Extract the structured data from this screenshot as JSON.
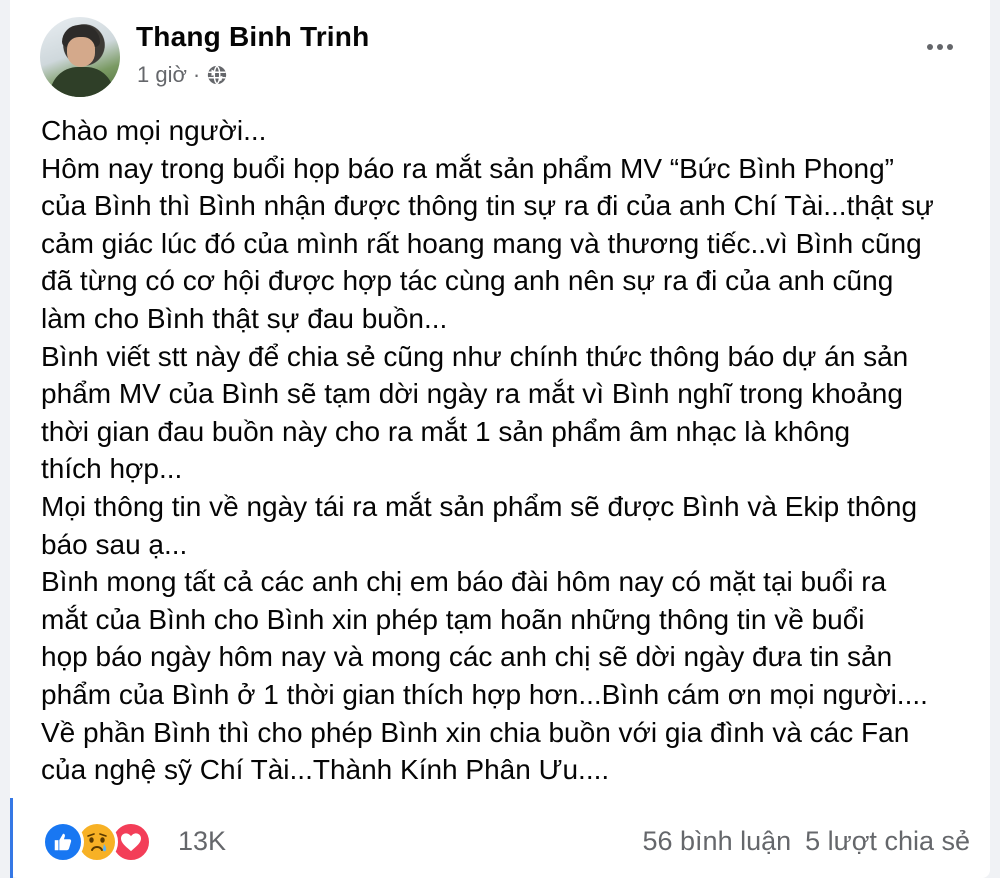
{
  "post": {
    "author": "Thang Binh Trinh",
    "time": "1 giờ",
    "separator": "·",
    "privacy_icon": "globe-icon",
    "lines": [
      "Chào mọi người...",
      "Hôm nay trong buổi họp báo ra mắt sản phẩm MV “Bức Bình Phong”",
      "của Bình thì Bình nhận được thông tin sự ra đi của anh Chí Tài...thật sự",
      "cảm giác lúc đó của mình rất hoang mang và thương tiếc..vì Bình cũng",
      "đã từng có cơ hội được hợp tác cùng anh nên sự ra đi của anh cũng",
      "làm cho Bình thật sự đau buồn...",
      "Bình viết stt này để chia sẻ cũng như chính thức thông báo dự án sản",
      "phẩm MV của Bình sẽ tạm dời ngày ra mắt vì Bình nghĩ trong khoảng",
      "thời gian đau buồn này cho ra mắt 1 sản phẩm âm nhạc là không",
      "thích hợp...",
      "Mọi thông tin về ngày tái ra mắt sản phẩm sẽ được Bình và Ekip thông",
      "báo sau ạ...",
      "Bình mong tất cả các anh chị em báo đài hôm nay có mặt tại buổi ra",
      "mắt của Bình cho Bình xin phép tạm hoãn những thông tin về buổi",
      "họp báo ngày hôm nay và mong các anh chị sẽ dời ngày đưa tin sản",
      "phẩm của Bình ở 1 thời gian thích hợp hơn...Bình cám ơn mọi người....",
      "Về phần Bình thì cho phép Bình xin chia buồn với gia đình và các Fan",
      "của nghệ sỹ Chí Tài...Thành Kính Phân Ưu...."
    ]
  },
  "footer": {
    "reactions": [
      "like-icon",
      "sad-icon",
      "love-icon"
    ],
    "reaction_count": "13K",
    "comments": "56 bình luận",
    "shares": "5 lượt chia sẻ"
  },
  "colors": {
    "like": "#1877f2",
    "sad": "#f7b125",
    "love": "#f33e58",
    "secondary_text": "#65676b"
  }
}
